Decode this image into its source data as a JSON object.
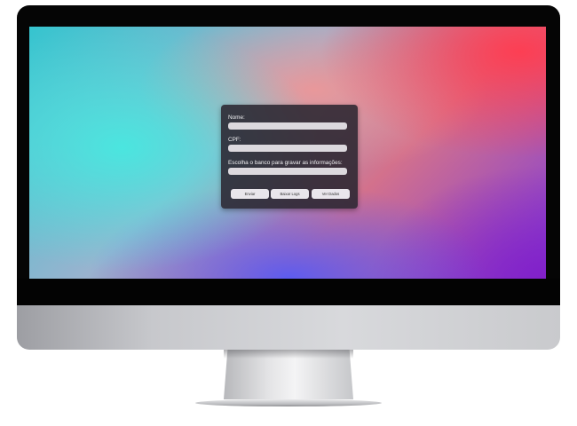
{
  "form": {
    "nome_label": "Nome:",
    "cpf_label": "CPF:",
    "banco_label": "Escolha o banco para gravar as informações:",
    "nome_value": "",
    "cpf_value": "",
    "banco_value": ""
  },
  "buttons": {
    "enviar": "Enviar",
    "baixar_log": "Baixar Logs",
    "ver_dados": "Ver Dados"
  },
  "colors": {
    "dialog_background": "#2a2630",
    "field_background": "#dcd9de",
    "button_background": "#e9e6ec"
  }
}
